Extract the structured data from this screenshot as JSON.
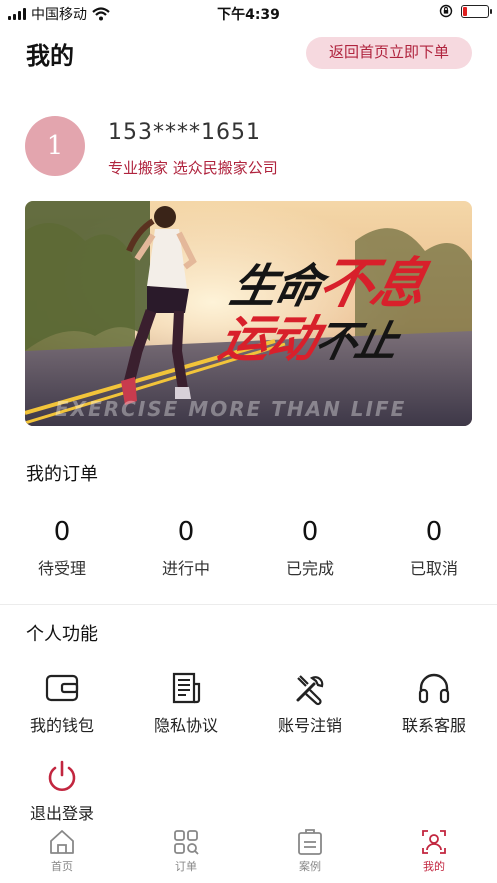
{
  "status_bar": {
    "carrier": "中国移动",
    "time": "下午4:39",
    "battery_level": 0.15
  },
  "header": {
    "title": "我的",
    "home_order_button": "返回首页立即下单"
  },
  "profile": {
    "avatar_text": "1",
    "phone": "153****1651",
    "subtitle": "专业搬家 选众民搬家公司"
  },
  "banner": {
    "line1_dark": "生命",
    "line1_red": "不息",
    "line2_red": "运动",
    "line2_dark": "不止",
    "motto": "EXERCISE MORE THAN LIFE"
  },
  "orders": {
    "title": "我的订单",
    "stats": [
      {
        "count": "0",
        "label": "待受理"
      },
      {
        "count": "0",
        "label": "进行中"
      },
      {
        "count": "0",
        "label": "已完成"
      },
      {
        "count": "0",
        "label": "已取消"
      }
    ]
  },
  "features": {
    "title": "个人功能",
    "items": [
      {
        "label": "我的钱包",
        "icon": "wallet-icon"
      },
      {
        "label": "隐私协议",
        "icon": "document-icon"
      },
      {
        "label": "账号注销",
        "icon": "tools-icon"
      },
      {
        "label": "联系客服",
        "icon": "headset-icon"
      },
      {
        "label": "退出登录",
        "icon": "power-icon"
      }
    ]
  },
  "tabbar": {
    "items": [
      {
        "label": "首页",
        "icon": "home-icon"
      },
      {
        "label": "订单",
        "icon": "grid-search-icon"
      },
      {
        "label": "案例",
        "icon": "clipboard-icon"
      },
      {
        "label": "我的",
        "icon": "user-icon"
      }
    ],
    "active_index": 3
  },
  "colors": {
    "accent": "#c2263f",
    "button_bg": "#f6d9df",
    "avatar_bg": "#e3a5ae"
  }
}
